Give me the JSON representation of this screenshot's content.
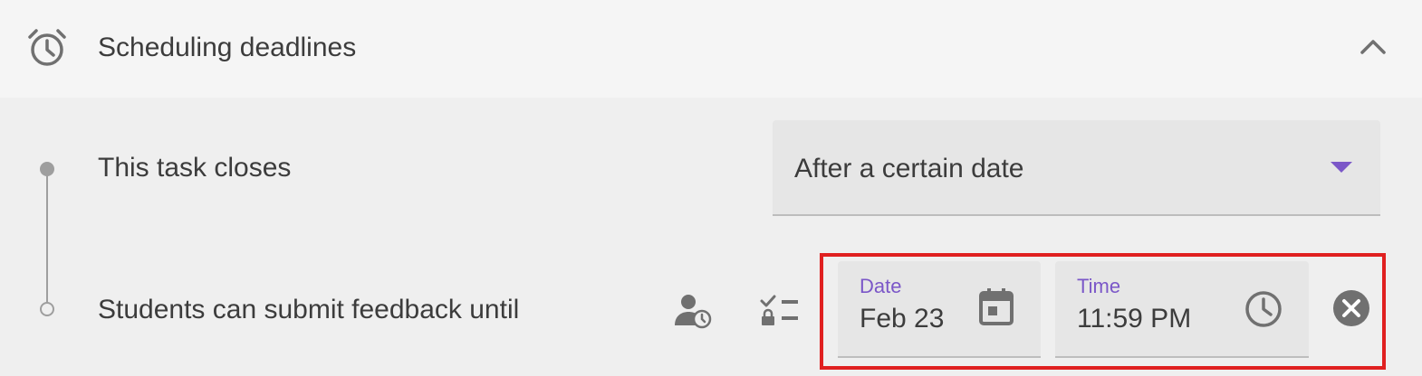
{
  "section": {
    "title": "Scheduling deadlines",
    "icon": "alarm-clock-icon",
    "collapse_icon": "chevron-up-icon"
  },
  "rows": [
    {
      "label": "This task closes",
      "select_value": "After a certain date",
      "select_icon": "dropdown-arrow-icon"
    },
    {
      "label": "Students can submit feedback until",
      "icons": [
        "person-clock-icon",
        "checklist-lock-icon"
      ],
      "date": {
        "label": "Date",
        "value": "Feb 23",
        "icon": "calendar-icon"
      },
      "time": {
        "label": "Time",
        "value": "11:59 PM",
        "icon": "clock-icon"
      },
      "clear_icon": "close-circle-icon"
    }
  ],
  "colors": {
    "accent": "#7b57c8",
    "highlight": "#e02020",
    "text": "#3c3c3c",
    "icon": "#707070",
    "timeline": "#9e9e9e"
  }
}
